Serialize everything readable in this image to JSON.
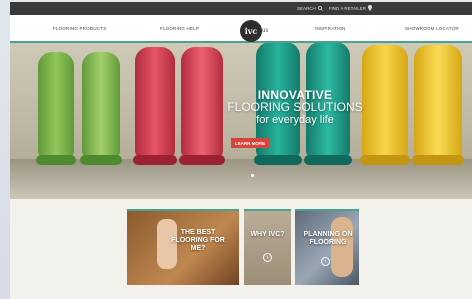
{
  "utility": {
    "search_label": "SEARCH",
    "retailer_label": "FIND A RETAILER"
  },
  "nav": {
    "items": [
      "FLOORING PRODUCTS",
      "FLOORING HELP",
      "INSPIRATION",
      "SHOWROOM LOCATOR"
    ],
    "logo_text": "ivc",
    "logo_suffix": "us"
  },
  "hero": {
    "line1": "INNOVATIVE",
    "line2": "FLOORING SOLUTIONS",
    "line3": "for everyday life",
    "cta": "LEARN MORE",
    "boot_colors": [
      "#7bb34a",
      "#e0425a",
      "#1e9e8a",
      "#f0c52a"
    ]
  },
  "tiles": [
    {
      "text": "THE BEST FLOORING FOR ME?"
    },
    {
      "text": "WHY IVC?"
    },
    {
      "text": "PLANNING ON FLOORING"
    }
  ],
  "colors": {
    "accent": "#4aa28e",
    "cta": "#d8443a"
  }
}
